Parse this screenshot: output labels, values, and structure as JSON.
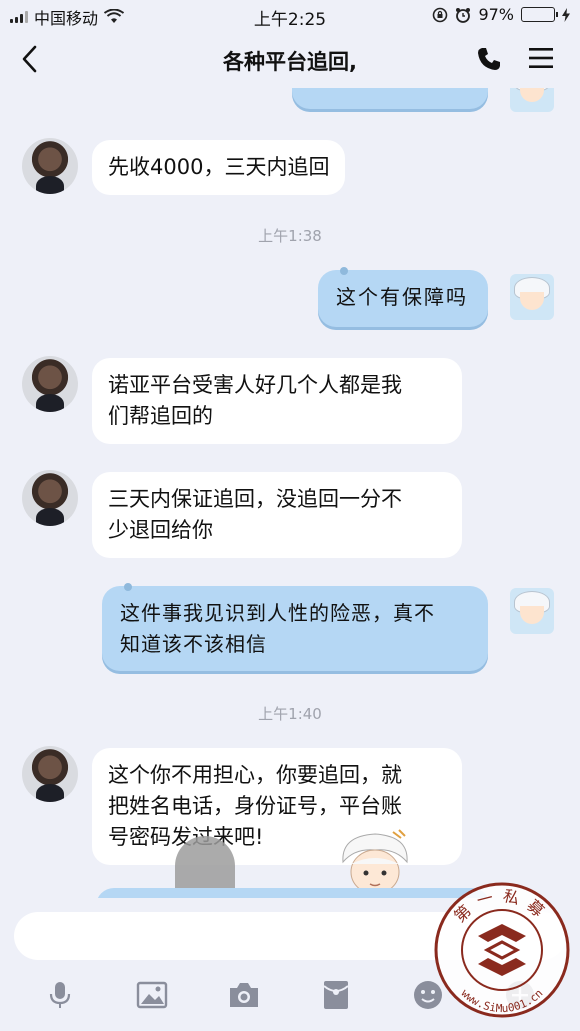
{
  "status": {
    "carrier": "中国移动",
    "time": "上午2:25",
    "battery": "97%",
    "battery_level": 0.97
  },
  "header": {
    "title": "各种平台追回,"
  },
  "messages": [
    {
      "side": "left",
      "text": "先收4000，三天内追回"
    },
    {
      "side": "right",
      "text": "这个有保障吗"
    },
    {
      "side": "left",
      "lines": [
        "诺亚平台受害人好几个人都是我",
        "们帮追回的"
      ]
    },
    {
      "side": "left",
      "lines": [
        "三天内保证追回，没追回一分不",
        "少退回给你"
      ]
    },
    {
      "side": "right",
      "lines": [
        "这件事我见识到人性的险恶，真不",
        "知道该不该相信"
      ]
    },
    {
      "side": "left",
      "lines": [
        "这个你不用担心，你要追回，就",
        "把姓名电话，身份证号，平台账",
        "号密码发过来吧!"
      ]
    }
  ],
  "timestamps": [
    "上午1:38",
    "上午1:40"
  ],
  "input": {
    "placeholder": ""
  },
  "toolbar": [
    "mic-icon",
    "image-icon",
    "camera-icon",
    "red-packet-icon",
    "emoji-icon",
    "plus-icon"
  ],
  "watermark": {
    "text": "第一私募",
    "url": "www.SiMu001.cn"
  },
  "colors": {
    "background": "#eef0f8",
    "left_bubble": "#ffffff",
    "right_bubble": "#b5d7f4",
    "battery": "#3cc753",
    "timestamp": "#a0a3ad"
  }
}
